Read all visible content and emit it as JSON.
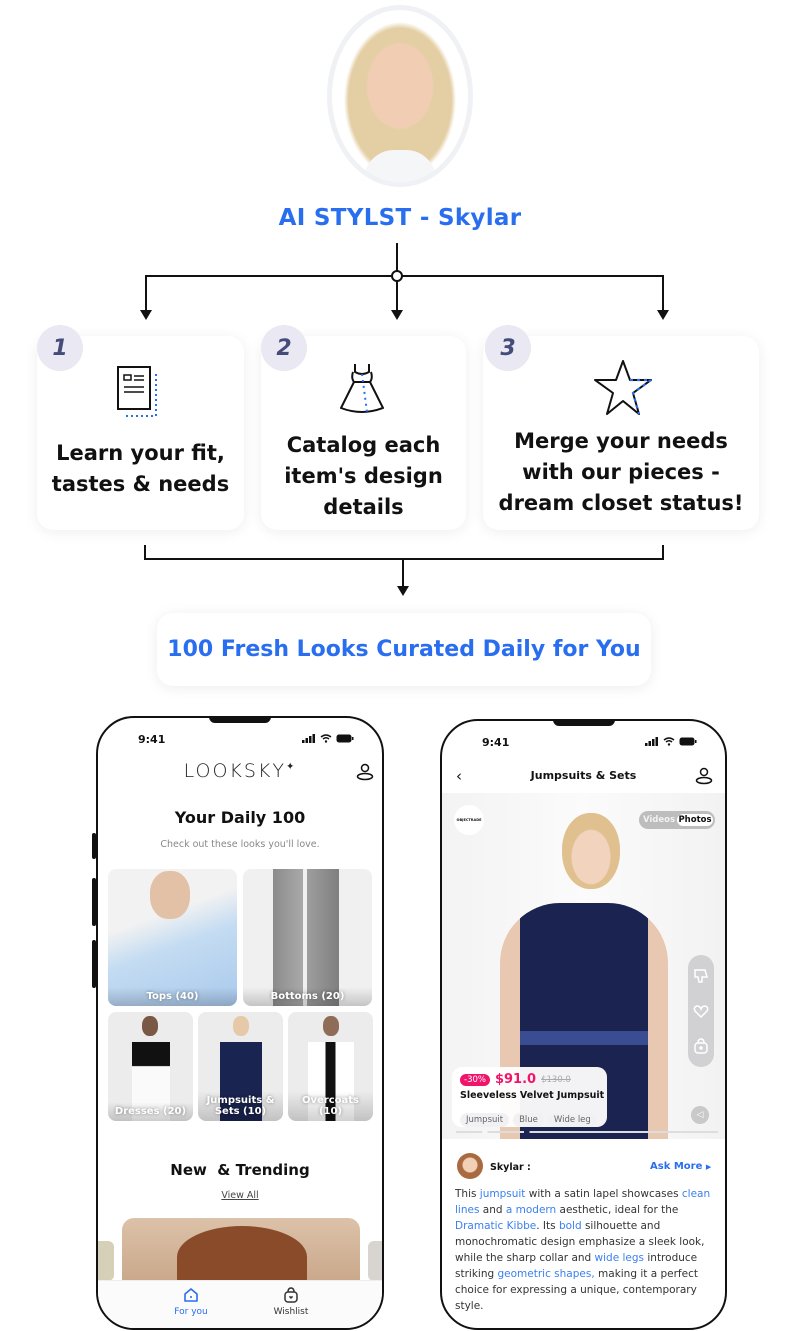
{
  "stylist": {
    "title": "AI STYLST - Skylar",
    "avatar_alt": "Skylar avatar"
  },
  "steps": [
    {
      "number": "1",
      "icon": "document-profile-icon",
      "text_lines": [
        "Learn your fit,",
        "tastes & needs"
      ]
    },
    {
      "number": "2",
      "icon": "dress-icon",
      "text_lines": [
        "Catalog each",
        "item's design",
        "details"
      ]
    },
    {
      "number": "3",
      "icon": "star-icon",
      "text_lines": [
        "Merge your needs",
        "with our pieces -",
        "dream closet status!"
      ]
    }
  ],
  "result": {
    "text": "100 Fresh Looks Curated Daily for You"
  },
  "colors": {
    "accent": "#2a6ef0",
    "number_bg": "#e9e8f3",
    "sale": "#f0156a"
  },
  "phone_left": {
    "time": "9:41",
    "brand": "LOOKSKY",
    "title": "Your Daily 100",
    "subtitle": "Check out these looks you'll love.",
    "categories": [
      {
        "label": "Tops (40)"
      },
      {
        "label": "Bottoms (20)"
      },
      {
        "label": "Dresses (20)"
      },
      {
        "label": "Jumpsuits & Sets (10)"
      },
      {
        "label": "Overcoats (10)"
      }
    ],
    "section_title": "New  & Trending",
    "view_all": "View All",
    "tabs": [
      {
        "label": "For you",
        "icon": "home-icon",
        "active": true
      },
      {
        "label": "Wishlist",
        "icon": "bag-heart-icon",
        "active": false
      }
    ]
  },
  "phone_right": {
    "time": "9:41",
    "title": "Jumpsuits & Sets",
    "brand_badge": "OBJECTRADE",
    "media_toggle": {
      "options": [
        "Videos",
        "Photos"
      ],
      "selected": "Photos"
    },
    "product": {
      "discount": "-30%",
      "price": "$91.0",
      "original_price": "$130.0",
      "name": "Sleeveless Velvet Jumpsuit",
      "tags": [
        "Jumpsuit",
        "Blue",
        "Wide leg"
      ]
    },
    "stylist_label": "Skylar :",
    "ask_more": "Ask More",
    "description": [
      {
        "t": "This "
      },
      {
        "t": "jumpsuit",
        "h": true
      },
      {
        "t": " with a satin lapel showcases "
      },
      {
        "t": "clean lines",
        "h": true
      },
      {
        "t": " and "
      },
      {
        "t": "a modern",
        "h": true
      },
      {
        "t": " aesthetic, ideal for the "
      },
      {
        "t": "Dramatic Kibbe",
        "h": true
      },
      {
        "t": ". Its "
      },
      {
        "t": "bold",
        "h": true
      },
      {
        "t": " silhouette and monochromatic design emphasize a sleek look, while the sharp collar and "
      },
      {
        "t": "wide legs",
        "h": true
      },
      {
        "t": " introduce striking "
      },
      {
        "t": "geometric shapes,",
        "h": true
      },
      {
        "t": " making it a perfect choice for expressing a unique, contemporary style."
      }
    ]
  }
}
